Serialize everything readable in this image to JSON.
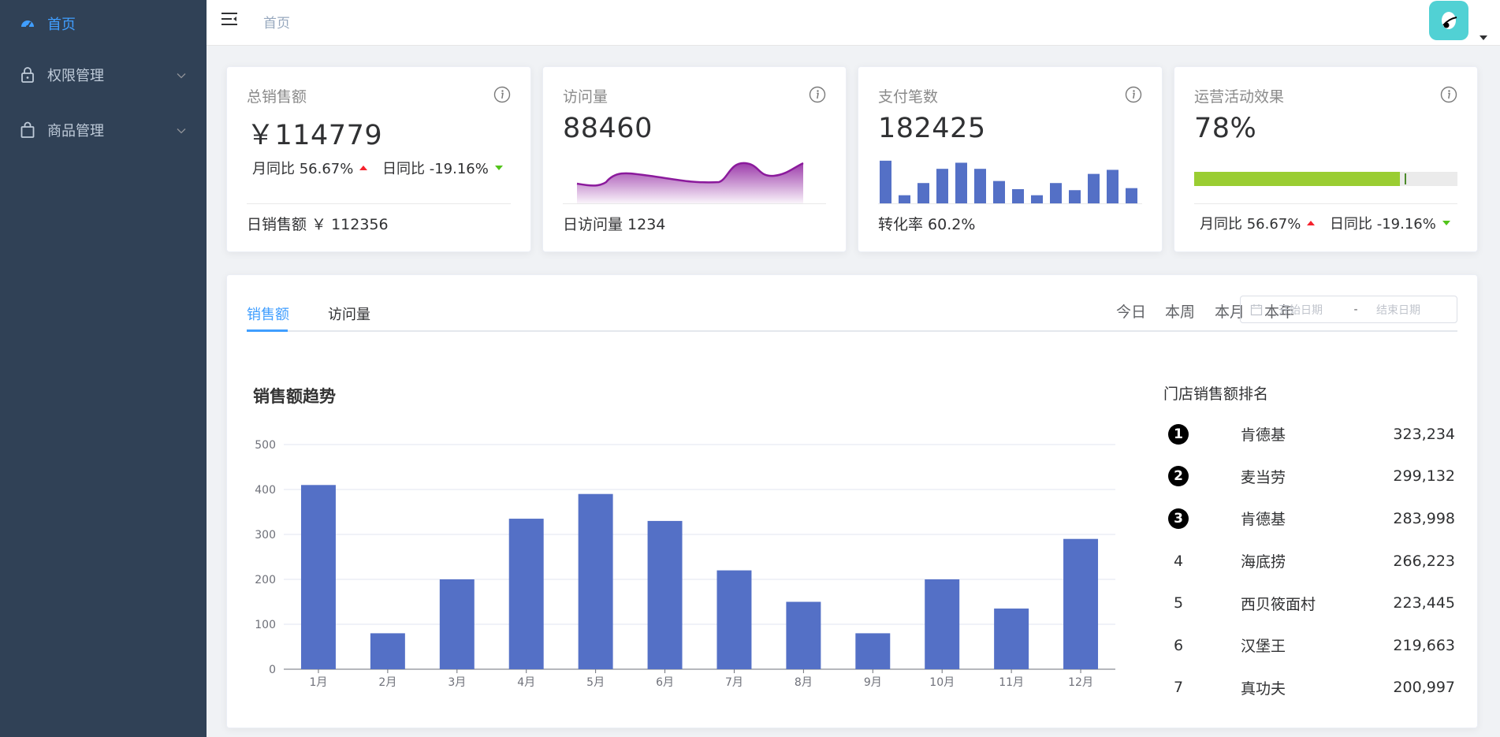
{
  "sidebar": {
    "items": [
      {
        "label": "首页",
        "icon": "dashboard-icon",
        "active": true
      },
      {
        "label": "权限管理",
        "icon": "lock-icon",
        "expandable": true
      },
      {
        "label": "商品管理",
        "icon": "shopping-bag-icon",
        "expandable": true
      }
    ],
    "bg_color": "#304156",
    "active_color": "#409eff"
  },
  "header": {
    "breadcrumb": "首页",
    "avatar_icon": "avatar-icon"
  },
  "cards": [
    {
      "title": "总销售额",
      "value": "￥114779",
      "month_compare": "月同比 56.67%",
      "day_compare": "日同比 -19.16%",
      "footer": "日销售额 ￥ 112356"
    },
    {
      "title": "访问量",
      "value": "88460",
      "footer": "日访问量 1234",
      "sparkline_color": "#8b1a9c"
    },
    {
      "title": "支付笔数",
      "value": "182425",
      "footer": "转化率 60.2%",
      "mini_bars": [
        42,
        8,
        20,
        34,
        40,
        34,
        22,
        14,
        8,
        20,
        13,
        29,
        33,
        15
      ]
    },
    {
      "title": "运营活动效果",
      "value": "78%",
      "progress": 0.78,
      "progress_color": "#9acd32",
      "month_compare": "月同比 56.67%",
      "day_compare": "日同比 -19.16%"
    }
  ],
  "panel": {
    "tabs": [
      "销售额",
      "访问量"
    ],
    "active_tab": 0,
    "ranges": [
      "今日",
      "本周",
      "本月",
      "本年"
    ],
    "date_start_placeholder": "开始日期",
    "date_sep": "-",
    "date_end_placeholder": "结束日期",
    "chart_title": "销售额趋势",
    "rank_title": "门店销售额排名",
    "ranking": [
      {
        "no": "1",
        "name": "肯德基",
        "value": "323,234",
        "top": true
      },
      {
        "no": "2",
        "name": "麦当劳",
        "value": "299,132",
        "top": true
      },
      {
        "no": "3",
        "name": "肯德基",
        "value": "283,998",
        "top": true
      },
      {
        "no": "4",
        "name": "海底捞",
        "value": "266,223",
        "top": false
      },
      {
        "no": "5",
        "name": "西贝筱面村",
        "value": "223,445",
        "top": false
      },
      {
        "no": "6",
        "name": "汉堡王",
        "value": "219,663",
        "top": false
      },
      {
        "no": "7",
        "name": "真功夫",
        "value": "200,997",
        "top": false
      }
    ]
  },
  "chart_data": {
    "type": "bar",
    "title": "销售额趋势",
    "categories": [
      "1月",
      "2月",
      "3月",
      "4月",
      "5月",
      "6月",
      "7月",
      "8月",
      "9月",
      "10月",
      "11月",
      "12月"
    ],
    "values": [
      410,
      80,
      200,
      335,
      390,
      330,
      220,
      150,
      80,
      200,
      135,
      290
    ],
    "ylim": [
      0,
      500
    ],
    "yticks": [
      0,
      100,
      200,
      300,
      400,
      500
    ],
    "grid": true,
    "bar_color": "#5470c6"
  }
}
